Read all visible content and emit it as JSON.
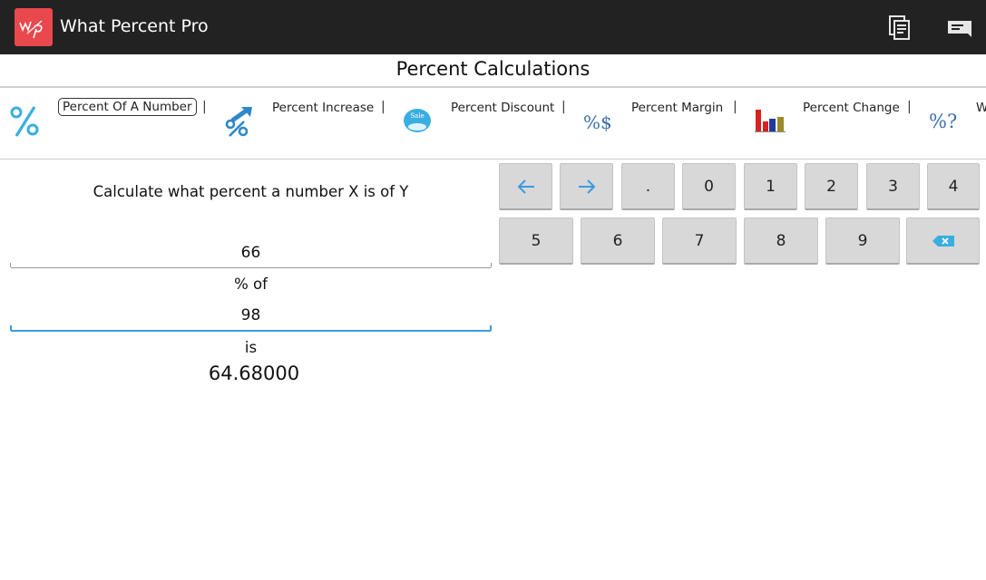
{
  "app": {
    "title": "What Percent Pro",
    "icon_text": "w%p"
  },
  "actions": {
    "copy_icon": "copy-icon",
    "menu_icon": "overflow-menu-icon"
  },
  "section": {
    "title": "Percent Calculations"
  },
  "tabs": [
    {
      "label": "Percent Of A Number",
      "icon": "percent-icon",
      "active": true
    },
    {
      "label": "Percent Increase",
      "icon": "percent-increase-icon"
    },
    {
      "label": "Percent Discount",
      "icon": "sale-badge-icon"
    },
    {
      "label": "Percent Margin",
      "icon": "percent-dollar-icon"
    },
    {
      "label": "Percent Change",
      "icon": "bar-chart-icon"
    },
    {
      "label": "W",
      "icon": "percent-question-icon"
    }
  ],
  "tab_separator": "|",
  "sale_badge_text": "Sale",
  "percent_dollar_text": "%$",
  "percent_question_text": "%?",
  "calculator": {
    "description": "Calculate what percent a number X is of Y",
    "x_value": "66",
    "of_label": "% of",
    "y_value": "98",
    "is_label": "is",
    "result": "64.68000"
  },
  "keypad": {
    "row1": [
      "left-arrow-icon",
      "right-arrow-icon",
      ".",
      "0",
      "1",
      "2",
      "3",
      "4"
    ],
    "row2": [
      "5",
      "6",
      "7",
      "8",
      "9",
      "backspace-icon"
    ]
  },
  "colors": {
    "action_bar": "#222222",
    "app_icon": "#e9484d",
    "accent_blue": "#3b9be0",
    "key_bg": "#d8d8d8"
  }
}
